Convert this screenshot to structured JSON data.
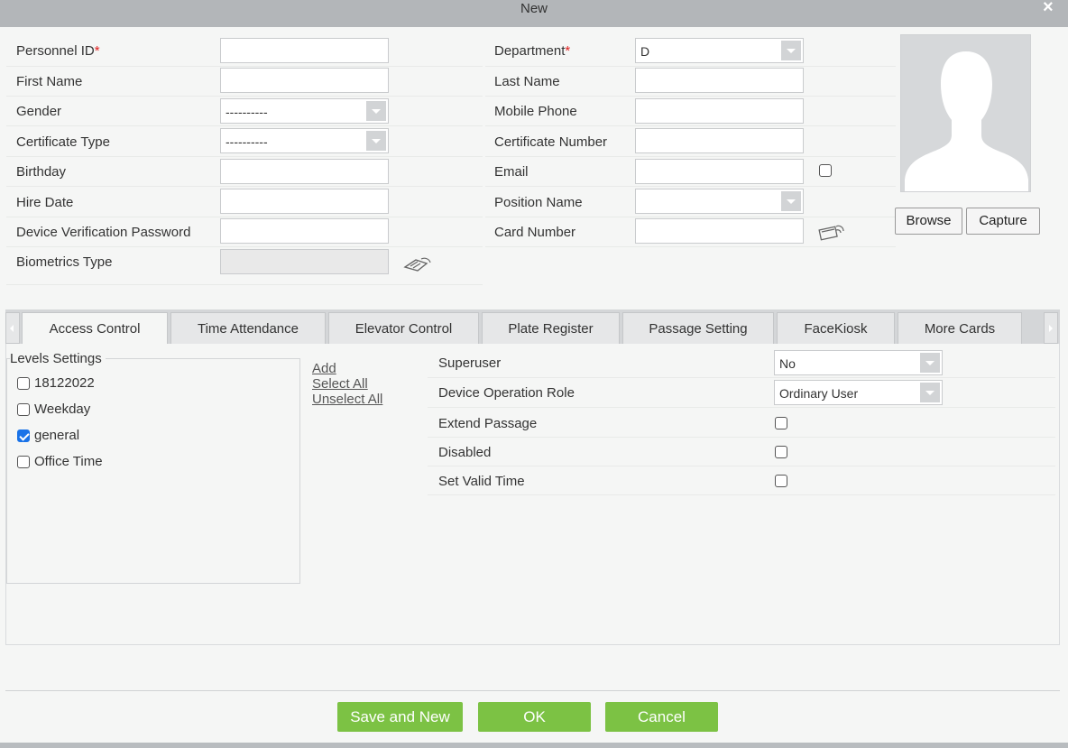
{
  "window": {
    "title": "New",
    "close_label": "×"
  },
  "form": {
    "personnel_id": {
      "label": "Personnel ID",
      "required_mark": "*",
      "value": ""
    },
    "first_name": {
      "label": "First Name",
      "value": ""
    },
    "gender": {
      "label": "Gender",
      "selected": "----------"
    },
    "certificate_type": {
      "label": "Certificate Type",
      "selected": "----------"
    },
    "birthday": {
      "label": "Birthday",
      "value": ""
    },
    "hire_date": {
      "label": "Hire Date",
      "value": ""
    },
    "device_password": {
      "label": "Device Verification Password",
      "value": ""
    },
    "biometrics_type": {
      "label": "Biometrics Type",
      "value": ""
    },
    "department": {
      "label": "Department",
      "required_mark": "*",
      "selected": "D"
    },
    "last_name": {
      "label": "Last Name",
      "value": ""
    },
    "mobile_phone": {
      "label": "Mobile Phone",
      "value": ""
    },
    "certificate_number": {
      "label": "Certificate Number",
      "value": ""
    },
    "email": {
      "label": "Email",
      "value": "",
      "checkbox_checked": false
    },
    "position_name": {
      "label": "Position Name",
      "selected": ""
    },
    "card_number": {
      "label": "Card Number",
      "value": ""
    }
  },
  "photo": {
    "browse_label": "Browse",
    "capture_label": "Capture"
  },
  "tabs": [
    {
      "label": "Access Control",
      "active": true
    },
    {
      "label": "Time Attendance",
      "active": false
    },
    {
      "label": "Elevator Control",
      "active": false
    },
    {
      "label": "Plate Register",
      "active": false
    },
    {
      "label": "Passage Setting",
      "active": false
    },
    {
      "label": "FaceKiosk",
      "active": false
    },
    {
      "label": "More Cards",
      "active": false
    }
  ],
  "access_control": {
    "levels_title": "Levels Settings",
    "levels": [
      {
        "label": "18122022",
        "checked": false
      },
      {
        "label": "Weekday",
        "checked": false
      },
      {
        "label": "general",
        "checked": true
      },
      {
        "label": "Office Time",
        "checked": false
      }
    ],
    "links": {
      "add": "Add",
      "select_all": "Select All",
      "unselect_all": "Unselect All"
    },
    "superuser": {
      "label": "Superuser",
      "selected": "No"
    },
    "device_role": {
      "label": "Device Operation Role",
      "selected": "Ordinary User"
    },
    "extend_passage": {
      "label": "Extend Passage",
      "checked": false
    },
    "disabled": {
      "label": "Disabled",
      "checked": false
    },
    "set_valid_time": {
      "label": "Set Valid Time",
      "checked": false
    }
  },
  "footer": {
    "save_new_label": "Save and New",
    "ok_label": "OK",
    "cancel_label": "Cancel"
  },
  "colors": {
    "accent_green": "#7cc244",
    "titlebar": "#b3b6b9",
    "required": "#e02020",
    "check_blue": "#1a73e8"
  }
}
